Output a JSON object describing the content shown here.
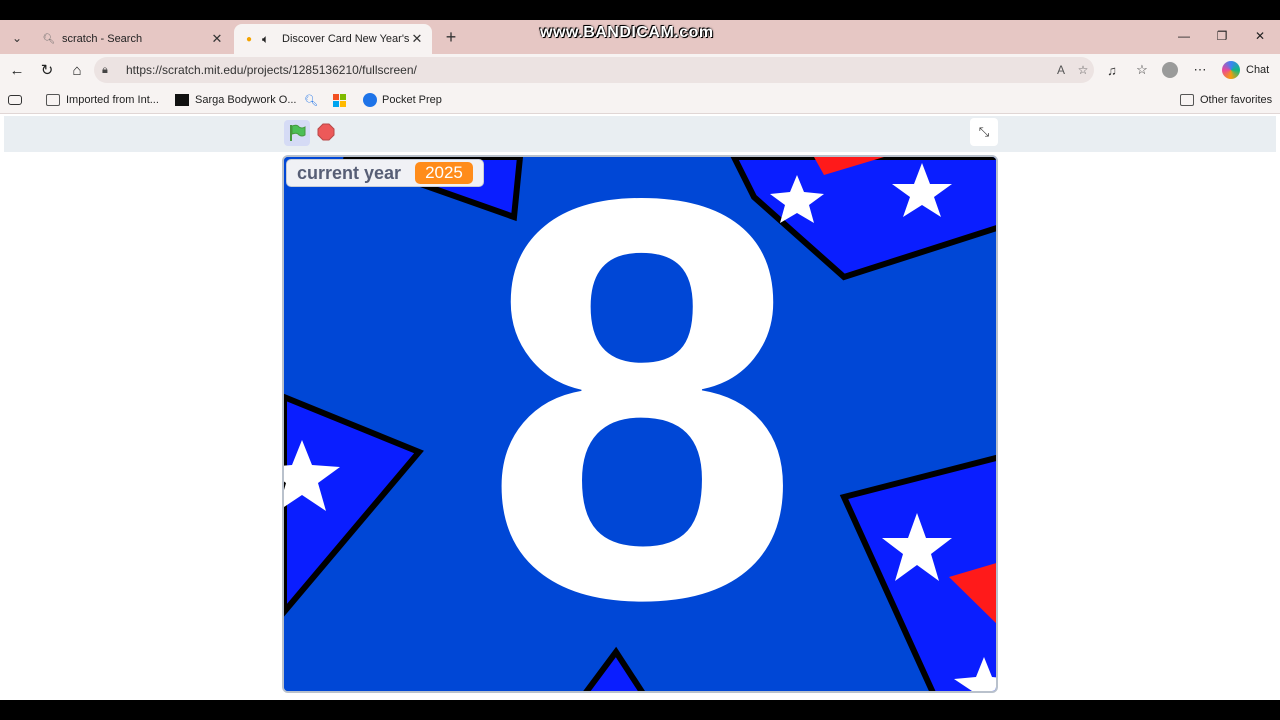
{
  "watermark": "www.BANDICAM.com",
  "tabs": [
    {
      "title": "scratch - Search",
      "icon": "search-icon"
    },
    {
      "title": "Discover Card New Year's Cou",
      "icon": "scratch-favicon",
      "audio": true
    }
  ],
  "address": {
    "url": "https://scratch.mit.edu/projects/1285136210/fullscreen/"
  },
  "toolbar": {
    "chat_label": "Chat"
  },
  "bookmarks": {
    "items": [
      {
        "label": "Imported from Int..."
      },
      {
        "label": "Sarga Bodywork O..."
      },
      {
        "label": "Pocket Prep"
      }
    ],
    "other": "Other favorites"
  },
  "stage": {
    "monitor_label": "current year",
    "monitor_value": "2025",
    "big_digit": "8",
    "colors": {
      "background": "#0047d6",
      "stripe": "#0a1eff",
      "red": "#ff1a1a",
      "digit": "#ffffff",
      "orange": "#ff8c1a"
    }
  }
}
